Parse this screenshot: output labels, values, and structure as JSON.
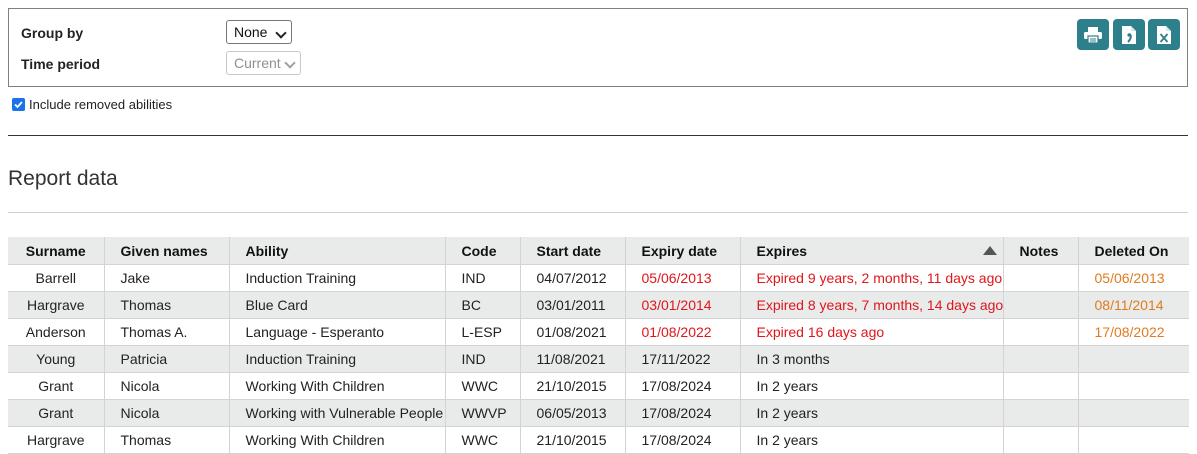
{
  "filters": {
    "group_by_label": "Group by",
    "group_by_value": "None",
    "time_period_label": "Time period",
    "time_period_value": "Current"
  },
  "export": {
    "print_icon": "printer-icon",
    "pdf_icon": "pdf-file-icon",
    "excel_icon": "excel-file-icon",
    "color": "#2e7f8c"
  },
  "include_removed": {
    "label": "Include removed abilities",
    "checked": true
  },
  "section_title": "Report data",
  "table": {
    "columns": [
      "Surname",
      "Given names",
      "Ability",
      "Code",
      "Start date",
      "Expiry date",
      "Expires",
      "Notes",
      "Deleted On"
    ],
    "sorted_column": "Expires",
    "sort_direction": "ascending",
    "rows": [
      {
        "surname": "Barrell",
        "given": "Jake",
        "ability": "Induction Training",
        "code": "IND",
        "start": "04/07/2012",
        "expiry": "05/06/2013",
        "expires": "Expired 9 years, 2 months, 11 days ago",
        "notes": "",
        "deleted": "05/06/2013"
      },
      {
        "surname": "Hargrave",
        "given": "Thomas",
        "ability": "Blue Card",
        "code": "BC",
        "start": "03/01/2011",
        "expiry": "03/01/2014",
        "expires": "Expired 8 years, 7 months, 14 days ago",
        "notes": "",
        "deleted": "08/11/2014"
      },
      {
        "surname": "Anderson",
        "given": "Thomas A.",
        "ability": "Language - Esperanto",
        "code": "L-ESP",
        "start": "01/08/2021",
        "expiry": "01/08/2022",
        "expires": "Expired 16 days ago",
        "notes": "",
        "deleted": "17/08/2022"
      },
      {
        "surname": "Young",
        "given": "Patricia",
        "ability": "Induction Training",
        "code": "IND",
        "start": "11/08/2021",
        "expiry": "17/11/2022",
        "expires": "In 3 months",
        "notes": "",
        "deleted": ""
      },
      {
        "surname": "Grant",
        "given": "Nicola",
        "ability": "Working With Children",
        "code": "WWC",
        "start": "21/10/2015",
        "expiry": "17/08/2024",
        "expires": "In 2 years",
        "notes": "",
        "deleted": ""
      },
      {
        "surname": "Grant",
        "given": "Nicola",
        "ability": "Working with Vulnerable People",
        "code": "WWVP",
        "start": "06/05/2013",
        "expiry": "17/08/2024",
        "expires": "In 2 years",
        "notes": "",
        "deleted": ""
      },
      {
        "surname": "Hargrave",
        "given": "Thomas",
        "ability": "Working With Children",
        "code": "WWC",
        "start": "21/10/2015",
        "expiry": "17/08/2024",
        "expires": "In 2 years",
        "notes": "",
        "deleted": ""
      }
    ]
  },
  "colors": {
    "expired": "#e0161b",
    "deleted": "#e07b1f",
    "row_alt": "#e9ebeb"
  }
}
